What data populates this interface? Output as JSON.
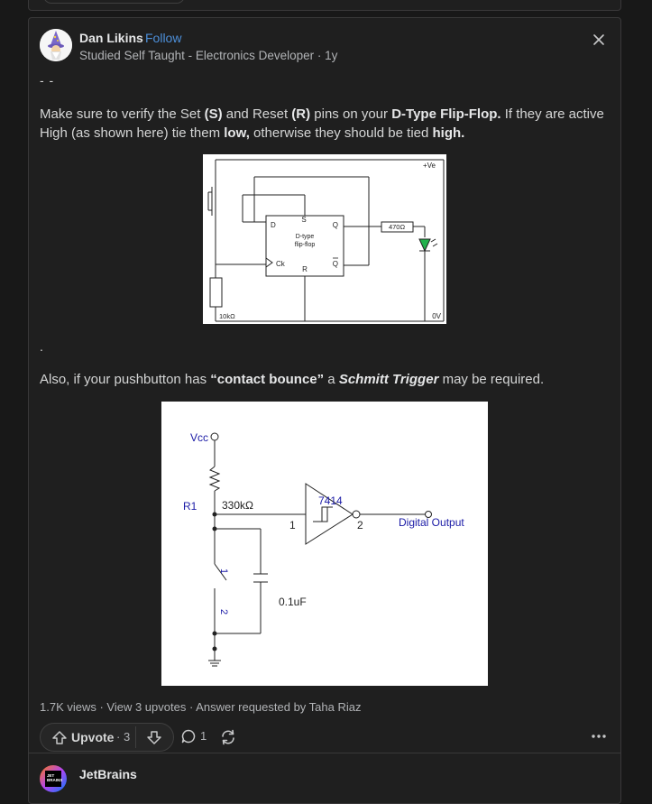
{
  "answer": {
    "author": {
      "name": "Dan Likins",
      "separator": "·",
      "follow_label": "Follow",
      "credential": "Studied Self Taught - Electronics Developer · 1y"
    },
    "body": {
      "dashes": "- -",
      "para1": {
        "t1": "Make sure to verify the Set ",
        "b1": "(S)",
        "t2": " and Reset ",
        "b2": "(R)",
        "t3": " pins on your ",
        "b3": "D-Type Flip-Flop.",
        "t4": " If they are active High (as shown here) tie them ",
        "b4": "low,",
        "t5": " otherwise they should be tied ",
        "b5": "high."
      },
      "dot": ".",
      "para2": {
        "t1": "Also, if your pushbutton has ",
        "b1": "“contact bounce”",
        "t2": " a ",
        "bi1": "Schmitt Trigger",
        "t3": " may be required."
      }
    },
    "figure1": {
      "vplus": "+Ve",
      "d": "D",
      "s": "S",
      "q": "Q",
      "label_line1": "D-type",
      "label_line2": "flip-flop",
      "ck": "Ck",
      "r": "R",
      "qbar": "Q",
      "resistor_470": "470Ω",
      "resistor_10k": "10kΩ",
      "ov": "0V"
    },
    "figure2": {
      "vcc": "Vcc",
      "r1": "R1",
      "r1_value": "330kΩ",
      "ic": "7414",
      "pin1": "1",
      "pin2": "2",
      "output": "Digital Output",
      "cap": "0.1uF",
      "sw1": "1",
      "sw2": "2"
    },
    "stats": "1.7K views · View 3 upvotes · Answer requested by Taha Riaz",
    "actions": {
      "upvote_label": "Upvote",
      "upvote_count": "· 3",
      "comment_count": "1"
    },
    "icons": {
      "close": "close-icon",
      "upvote": "upvote-arrow-icon",
      "downvote": "downvote-arrow-icon",
      "comment": "comment-bubble-icon",
      "share": "share-icon",
      "more": "more-dots-icon"
    },
    "colors": {
      "background": "#181818",
      "card": "#1f1f1f",
      "link": "#4d8fd9",
      "led": "#22b14c",
      "schematic_text": "#1a1aa6"
    }
  },
  "next_item": {
    "name": "JetBrains",
    "logo_text_line1": "JET",
    "logo_text_line2": "BRAINS"
  }
}
